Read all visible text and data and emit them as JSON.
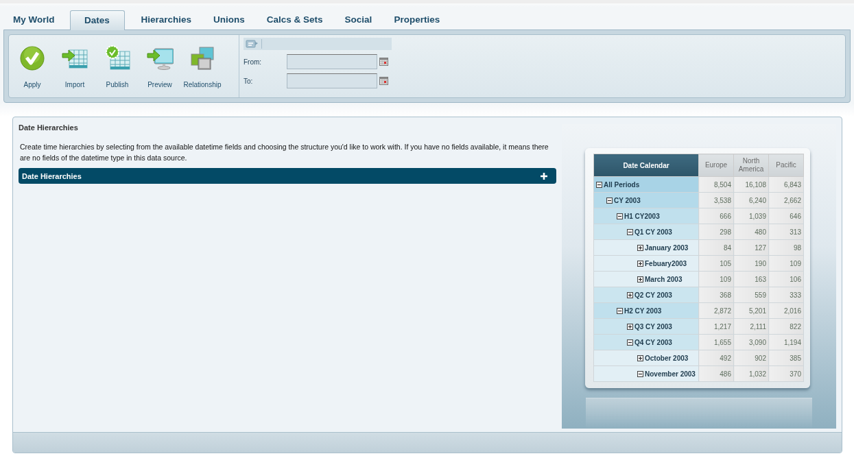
{
  "tabs": [
    {
      "label": "My World",
      "selected": false
    },
    {
      "label": "Dates",
      "selected": true
    },
    {
      "label": "Hierarchies",
      "selected": false
    },
    {
      "label": "Unions",
      "selected": false
    },
    {
      "label": "Calcs & Sets",
      "selected": false
    },
    {
      "label": "Social",
      "selected": false
    },
    {
      "label": "Properties",
      "selected": false
    }
  ],
  "toolbar": {
    "buttons": [
      {
        "label": "Apply",
        "kind": "apply"
      },
      {
        "label": "Import",
        "kind": "import"
      },
      {
        "label": "Publish",
        "kind": "publish"
      },
      {
        "label": "Preview",
        "kind": "preview"
      },
      {
        "label": "Relationship",
        "kind": "relationship"
      }
    ]
  },
  "date_range": {
    "fields": [
      {
        "label": "From:"
      },
      {
        "label": "To:"
      }
    ]
  },
  "section": {
    "title": "Date Hierarchies",
    "description": "Create time hierarchies by selecting from the available datetime fields and choosing the structure you'd like to work with. If you have no fields available, it means there are no fields of the datetime type in this data source.",
    "bar": {
      "title": "Date Hierarchies"
    }
  },
  "preview_table": {
    "columns": [
      "Date Calendar",
      "Europe",
      "North America",
      "Pacific"
    ],
    "rows": [
      {
        "label": "All Periods",
        "expanded": true,
        "values": [
          "8,504",
          "16,108",
          "6,843"
        ],
        "children": [
          {
            "label": "CY 2003",
            "expanded": true,
            "values": [
              "3,538",
              "6,240",
              "2,662"
            ],
            "children": [
              {
                "label": "H1 CY2003",
                "expanded": true,
                "values": [
                  "666",
                  "1,039",
                  "646"
                ],
                "children": [
                  {
                    "label": "Q1 CY 2003",
                    "expanded": true,
                    "values": [
                      "298",
                      "480",
                      "313"
                    ],
                    "children": [
                      {
                        "label": "January 2003",
                        "expanded": false,
                        "values": [
                          "84",
                          "127",
                          "98"
                        ]
                      },
                      {
                        "label": "Febuary2003",
                        "expanded": false,
                        "values": [
                          "105",
                          "190",
                          "109"
                        ]
                      },
                      {
                        "label": "March 2003",
                        "expanded": false,
                        "values": [
                          "109",
                          "163",
                          "106"
                        ]
                      }
                    ]
                  },
                  {
                    "label": "Q2 CY 2003",
                    "expanded": false,
                    "values": [
                      "368",
                      "559",
                      "333"
                    ]
                  }
                ]
              },
              {
                "label": "H2 CY 2003",
                "expanded": true,
                "values": [
                  "2,872",
                  "5,201",
                  "2,016"
                ],
                "children": [
                  {
                    "label": "Q3 CY 2003",
                    "expanded": false,
                    "values": [
                      "1,217",
                      "2,111",
                      "822"
                    ]
                  },
                  {
                    "label": "Q4 CY 2003",
                    "expanded": true,
                    "values": [
                      "1,655",
                      "3,090",
                      "1,194"
                    ],
                    "children": [
                      {
                        "label": "October 2003",
                        "expanded": false,
                        "values": [
                          "492",
                          "902",
                          "385"
                        ]
                      },
                      {
                        "label": "November 2003",
                        "expanded": true,
                        "values": [
                          "486",
                          "1,032",
                          "370"
                        ]
                      }
                    ]
                  }
                ]
              }
            ]
          }
        ]
      }
    ]
  }
}
